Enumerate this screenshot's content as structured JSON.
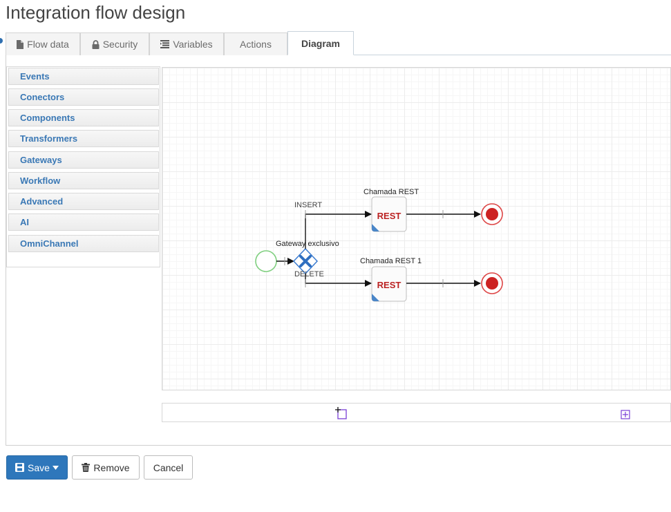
{
  "page": {
    "title": "Integration flow design"
  },
  "tabs": [
    {
      "label": "Flow data",
      "icon": "file-icon"
    },
    {
      "label": "Security",
      "icon": "lock-icon"
    },
    {
      "label": "Variables",
      "icon": "list-icon"
    },
    {
      "label": "Actions",
      "icon": ""
    },
    {
      "label": "Diagram",
      "icon": "",
      "active": true
    }
  ],
  "palette": {
    "items": [
      "Events",
      "Conectors",
      "Components",
      "Transformers",
      "Gateways",
      "Workflow",
      "Advanced",
      "AI",
      "OmniChannel"
    ]
  },
  "diagram": {
    "gateway_label": "Gateway exclusivo",
    "branch_top_label": "INSERT",
    "branch_bottom_label": "DELETE",
    "task_top_label": "Chamada REST",
    "task_bottom_label": "Chamada REST 1",
    "task_icon_text": "REST",
    "colors": {
      "start": "#7fcf7f",
      "end": "#cc2222",
      "gateway": "#2f6fc0"
    }
  },
  "actions": {
    "save_label": "Save",
    "remove_label": "Remove",
    "cancel_label": "Cancel"
  }
}
